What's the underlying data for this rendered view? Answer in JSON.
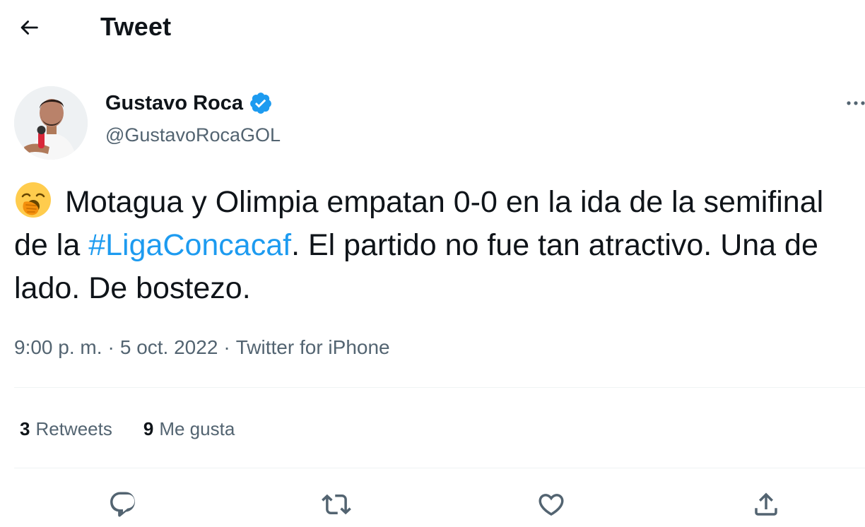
{
  "header": {
    "title": "Tweet",
    "back_icon": "arrow-left-icon"
  },
  "author": {
    "name": "Gustavo Roca",
    "handle": "@GustavoRocaGOL",
    "verified": true,
    "verified_icon": "verified-badge-icon"
  },
  "tweet": {
    "emoji": "yawning-face-emoji",
    "text_part1": "Motagua y Olimpia empatan 0-0 en la ida de la semifinal de la ",
    "hashtag": "#LigaConcacaf",
    "text_part2": ". El partido no fue tan atractivo. Una de lado. De bostezo."
  },
  "meta": {
    "time": "9:00 p. m.",
    "separator": "·",
    "date": "5 oct. 2022",
    "source": "Twitter for iPhone"
  },
  "stats": {
    "retweets_count": "3",
    "retweets_label": "Retweets",
    "likes_count": "9",
    "likes_label": "Me gusta"
  },
  "actions": {
    "reply_icon": "reply-icon",
    "retweet_icon": "retweet-icon",
    "like_icon": "heart-icon",
    "share_icon": "share-icon"
  },
  "colors": {
    "accent": "#1d9bf0",
    "text_primary": "#0f1419",
    "text_secondary": "#536471",
    "divider": "#eff3f4"
  }
}
